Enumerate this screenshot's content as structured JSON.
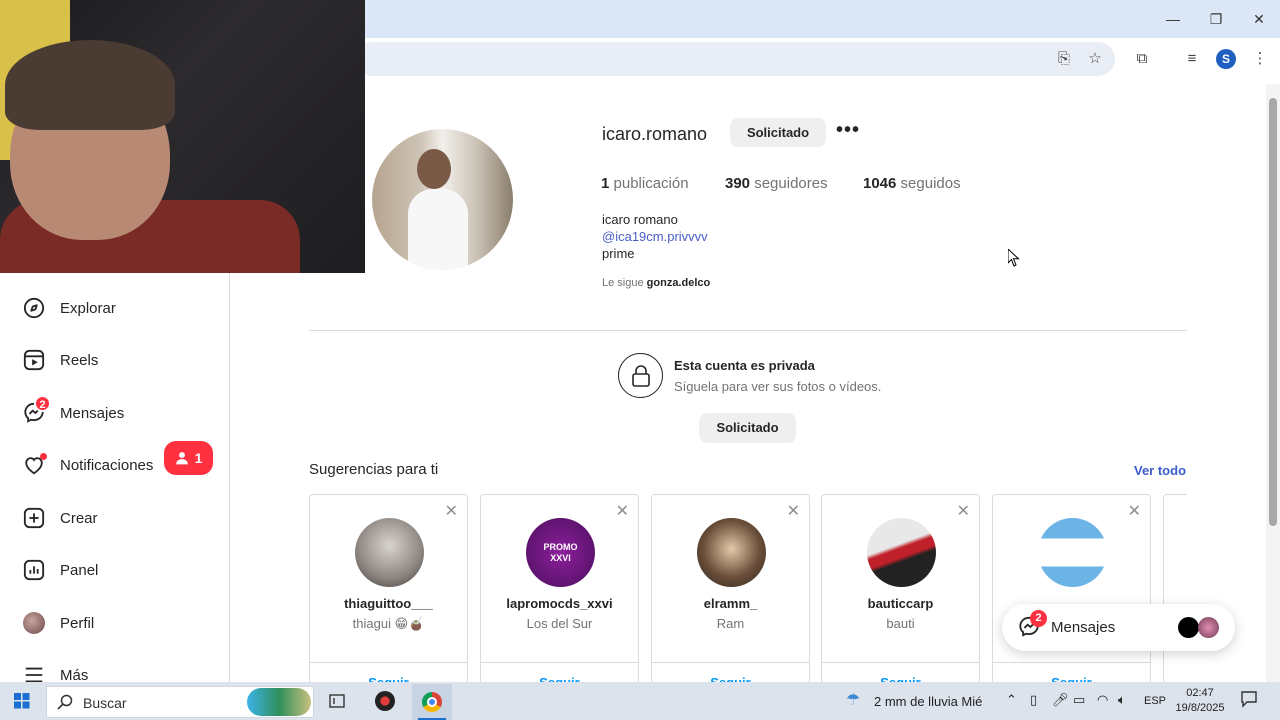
{
  "window": {
    "minimize_icon": "minimize-icon",
    "restore_icon": "restore-icon",
    "close_icon": "close-icon"
  },
  "browser": {
    "account_initial": "S"
  },
  "sidebar": {
    "items": [
      {
        "label": "Explorar",
        "icon": "compass-icon"
      },
      {
        "label": "Reels",
        "icon": "reels-icon"
      },
      {
        "label": "Mensajes",
        "icon": "messenger-icon",
        "badge": "2"
      },
      {
        "label": "Notificaciones",
        "icon": "heart-icon"
      },
      {
        "label": "Crear",
        "icon": "plus-square-icon"
      },
      {
        "label": "Panel",
        "icon": "chart-icon"
      },
      {
        "label": "Perfil",
        "icon": "profile-avatar"
      },
      {
        "label": "Más",
        "icon": "menu-icon"
      }
    ],
    "notification_pill": "1"
  },
  "profile": {
    "username": "icaro.romano",
    "request_button": "Solicitado",
    "stats": {
      "posts_count": "1",
      "posts_label": "publicación",
      "followers_count": "390",
      "followers_label": "seguidores",
      "following_count": "1046",
      "following_label": "seguidos"
    },
    "full_name": "icaro romano",
    "handle": "@ica19cm.privvvv",
    "bio": "prime",
    "followed_by_prefix": "Le sigue",
    "followed_by_user": "gonza.delco"
  },
  "private": {
    "title": "Esta cuenta es privada",
    "subtitle": "Síguela para ver sus fotos o vídeos.",
    "button": "Solicitado"
  },
  "suggestions": {
    "title": "Sugerencias para ti",
    "see_all": "Ver todo",
    "follow_label": "Seguir",
    "cards": [
      {
        "username": "thiaguittoo___",
        "sub": "thiagui 😁🧉"
      },
      {
        "username": "lapromocds_xxvi",
        "sub": "Los del Sur",
        "avatar_text": "PROMO XXVI"
      },
      {
        "username": "elramm_",
        "sub": "Ram"
      },
      {
        "username": "bauticcarp",
        "sub": "bauti"
      },
      {
        "username": "",
        "sub": ""
      }
    ]
  },
  "messages_float": {
    "label": "Mensajes",
    "badge": "2"
  },
  "taskbar": {
    "search_placeholder": "Buscar",
    "weather": "2 mm de lluvia Mié",
    "language": "ESP",
    "time": "02:47",
    "date": "19/8/2025"
  }
}
